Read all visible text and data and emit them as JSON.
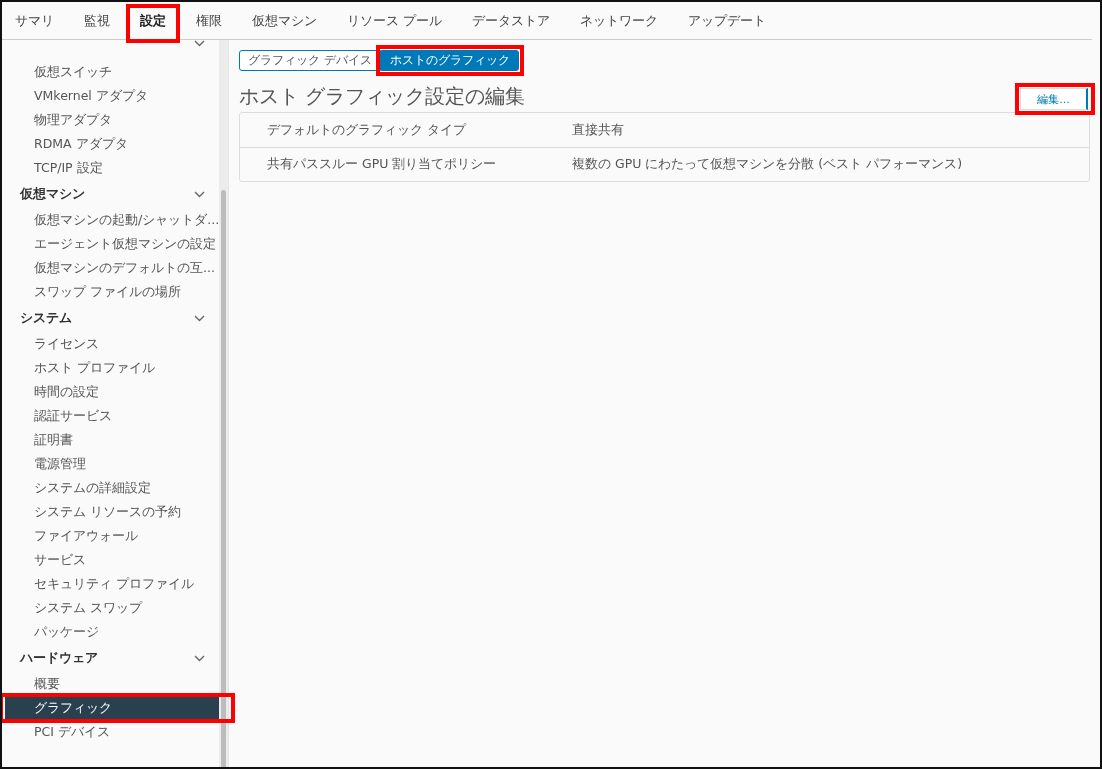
{
  "tabs": [
    {
      "label": "サマリ",
      "selected": false,
      "highlighted": false
    },
    {
      "label": "監視",
      "selected": false,
      "highlighted": false
    },
    {
      "label": "設定",
      "selected": true,
      "highlighted": true
    },
    {
      "label": "権限",
      "selected": false,
      "highlighted": false
    },
    {
      "label": "仮想マシン",
      "selected": false,
      "highlighted": false
    },
    {
      "label": "リソース プール",
      "selected": false,
      "highlighted": false
    },
    {
      "label": "データストア",
      "selected": false,
      "highlighted": false
    },
    {
      "label": "ネットワーク",
      "selected": false,
      "highlighted": false
    },
    {
      "label": "アップデート",
      "selected": false,
      "highlighted": false
    }
  ],
  "sidebar": {
    "groups": [
      {
        "expanded": true,
        "items": [
          {
            "label": "仮想スイッチ",
            "selected": false,
            "highlighted": false
          },
          {
            "label": "VMkernel アダプタ",
            "selected": false,
            "highlighted": false
          },
          {
            "label": "物理アダプタ",
            "selected": false,
            "highlighted": false
          },
          {
            "label": "RDMA アダプタ",
            "selected": false,
            "highlighted": false
          },
          {
            "label": "TCP/IP 設定",
            "selected": false,
            "highlighted": false
          }
        ]
      },
      {
        "label": "仮想マシン",
        "expanded": true,
        "items": [
          {
            "label": "仮想マシンの起動/シャットダ...",
            "selected": false,
            "highlighted": false
          },
          {
            "label": "エージェント仮想マシンの設定",
            "selected": false,
            "highlighted": false
          },
          {
            "label": "仮想マシンのデフォルトの互...",
            "selected": false,
            "highlighted": false
          },
          {
            "label": "スワップ ファイルの場所",
            "selected": false,
            "highlighted": false
          }
        ]
      },
      {
        "label": "システム",
        "expanded": true,
        "items": [
          {
            "label": "ライセンス",
            "selected": false,
            "highlighted": false
          },
          {
            "label": "ホスト プロファイル",
            "selected": false,
            "highlighted": false
          },
          {
            "label": "時間の設定",
            "selected": false,
            "highlighted": false
          },
          {
            "label": "認証サービス",
            "selected": false,
            "highlighted": false
          },
          {
            "label": "証明書",
            "selected": false,
            "highlighted": false
          },
          {
            "label": "電源管理",
            "selected": false,
            "highlighted": false
          },
          {
            "label": "システムの詳細設定",
            "selected": false,
            "highlighted": false
          },
          {
            "label": "システム リソースの予約",
            "selected": false,
            "highlighted": false
          },
          {
            "label": "ファイアウォール",
            "selected": false,
            "highlighted": false
          },
          {
            "label": "サービス",
            "selected": false,
            "highlighted": false
          },
          {
            "label": "セキュリティ プロファイル",
            "selected": false,
            "highlighted": false
          },
          {
            "label": "システム スワップ",
            "selected": false,
            "highlighted": false
          },
          {
            "label": "パッケージ",
            "selected": false,
            "highlighted": false
          }
        ]
      },
      {
        "label": "ハードウェア",
        "expanded": true,
        "items": [
          {
            "label": "概要",
            "selected": false,
            "highlighted": false
          },
          {
            "label": "グラフィック",
            "selected": true,
            "highlighted": true
          },
          {
            "label": "PCI デバイス",
            "selected": false,
            "highlighted": false
          }
        ]
      }
    ]
  },
  "subtabs": [
    {
      "label": "グラフィック デバイス",
      "selected": false,
      "highlighted": false
    },
    {
      "label": "ホストのグラフィック",
      "selected": true,
      "highlighted": true
    }
  ],
  "heading": "ホスト グラフィック設定の編集",
  "edit_button": {
    "label": "編集...",
    "highlighted": true
  },
  "settings": [
    {
      "name": "デフォルトのグラフィック タイプ",
      "value": "直接共有"
    },
    {
      "name": "共有パススルー GPU 割り当てポリシー",
      "value": "複数の GPU にわたって仮想マシンを分散 (ベスト パフォーマンス)"
    }
  ]
}
